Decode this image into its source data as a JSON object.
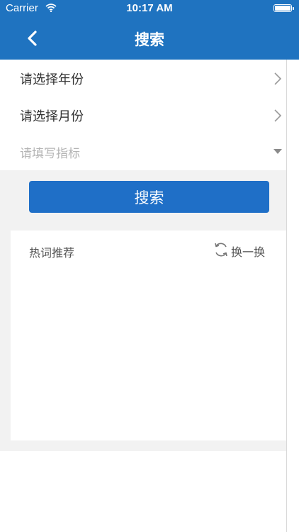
{
  "status_bar": {
    "carrier": "Carrier",
    "time": "10:17 AM"
  },
  "nav": {
    "title": "搜索"
  },
  "filters": {
    "year": "请选择年份",
    "month": "请选择月份",
    "indicator_placeholder": "请填写指标"
  },
  "search_button": "搜索",
  "hot": {
    "title": "热词推荐",
    "refresh_label": "换一换"
  },
  "colors": {
    "primary": "#1f73c0",
    "background_gray": "#f2f2f2"
  },
  "icons": [
    "wifi-icon",
    "battery-icon",
    "back-chevron-icon",
    "chevron-right-icon",
    "caret-down-icon",
    "refresh-icon"
  ]
}
